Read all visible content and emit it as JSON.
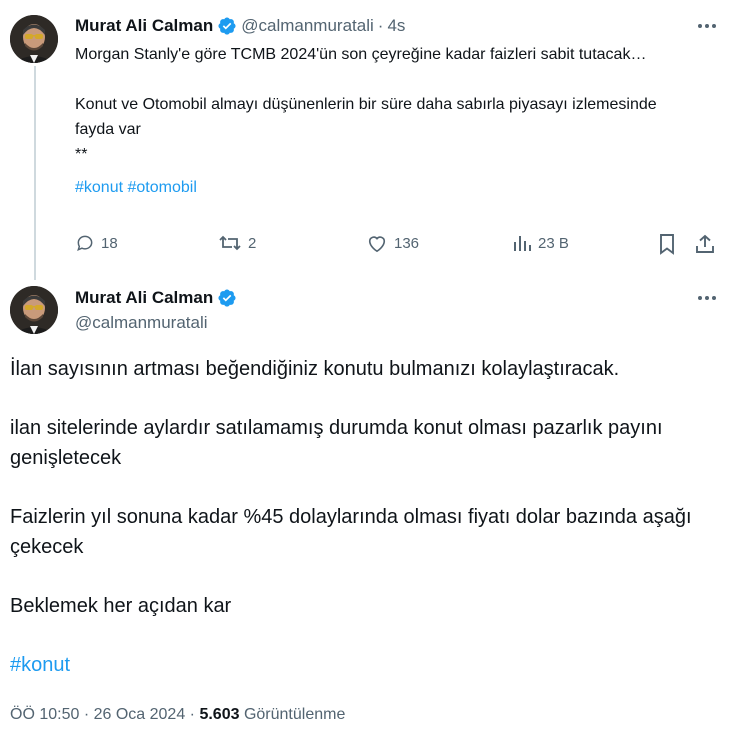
{
  "tweet1": {
    "author_name": "Murat Ali Calman",
    "handle": "@calmanmuratali",
    "separator": "·",
    "time": "4s",
    "text": "Morgan Stanly'e göre TCMB 2024'ün son çeyreğine kadar faizleri sabit tutacak…\n\nKonut ve Otomobil almayı düşünenlerin bir süre daha sabırla piyasayı izlemesinde fayda var\n**",
    "hashtags": [
      "#konut",
      "#otomobil"
    ],
    "replies": "18",
    "retweets": "2",
    "likes": "136",
    "views": "23 B"
  },
  "tweet2": {
    "author_name": "Murat Ali Calman",
    "handle": "@calmanmuratali",
    "paragraphs": [
      "İlan sayısının artması beğendiğiniz konutu bulmanızı kolaylaştıracak.",
      "ilan sitelerinde aylardır satılamamış durumda konut olması pazarlık payını genişletecek",
      "Faizlerin yıl sonuna kadar %45 dolaylarında olması fiyatı dolar bazında aşağı çekecek",
      "Beklemek her açıdan kar"
    ],
    "hashtag": "#konut",
    "timestamp": "ÖÖ 10:50 · 26 Oca 2024 ·",
    "view_count": "5.603",
    "views_label": "Görüntülenme"
  },
  "colors": {
    "accent": "#1d9bf0",
    "text": "#0f1419",
    "secondary": "#536471",
    "thread_line": "#cfd9de"
  },
  "icons": [
    "verified-badge-icon",
    "more-icon",
    "reply-icon",
    "retweet-icon",
    "like-icon",
    "views-icon",
    "bookmark-icon",
    "share-icon"
  ]
}
